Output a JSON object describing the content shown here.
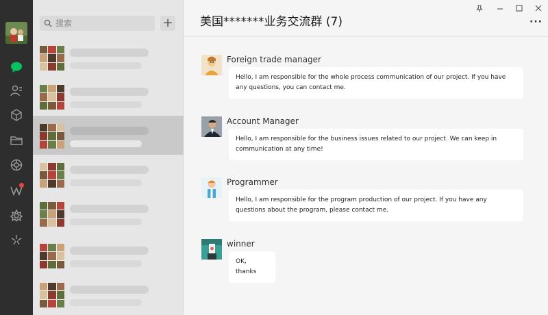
{
  "search": {
    "placeholder": "搜索",
    "add_label": "+"
  },
  "conversations": [
    {},
    {},
    {
      "active": true
    },
    {},
    {},
    {},
    {}
  ],
  "chat": {
    "title": "美国*******业务交流群 (7)",
    "more": "···",
    "window_controls": [
      "pin-icon",
      "minimize-icon",
      "maximize-icon",
      "close-icon"
    ],
    "messages": [
      {
        "sender": "Foreign trade manager",
        "text": "Hello, I am responsible for the whole process communication of our project. If you have any questions, you can contact me."
      },
      {
        "sender": "Account Manager",
        "text": "Hello, I am responsible for the business issues related to our project. We can keep in communication at any time!"
      },
      {
        "sender": "Programmer",
        "text": "Hello, I am responsible for the program production of our project. If you have any questions about the program, please contact me."
      },
      {
        "sender": "winner",
        "text": "OK, thanks"
      }
    ]
  },
  "colors": {
    "rail": "#2e2e2e",
    "accent": "#07c160",
    "list_bg": "#e6e6e6",
    "active_item": "#c9c9c9",
    "badge": "#e64340"
  }
}
